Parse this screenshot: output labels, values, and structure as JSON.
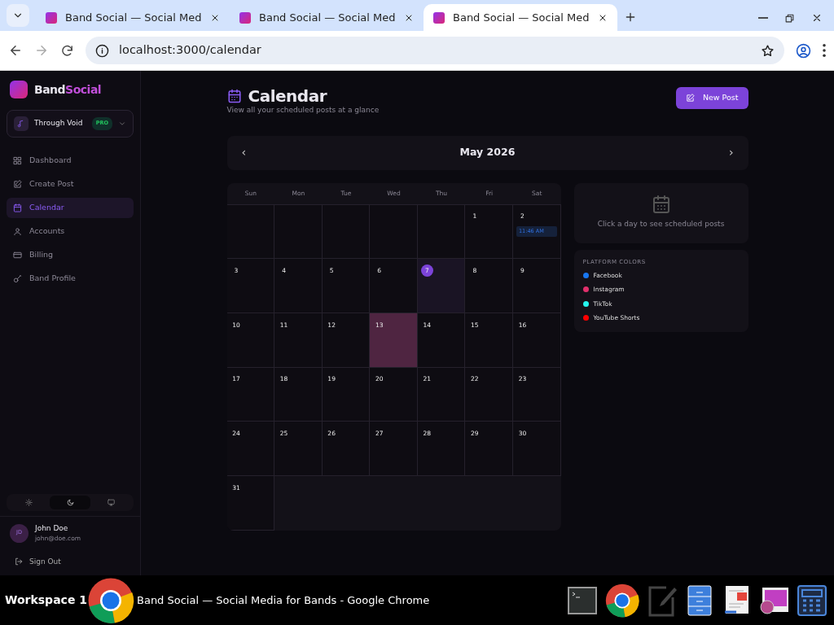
{
  "browser": {
    "tabs": [
      {
        "title": "Band Social — Social Med",
        "selected": false
      },
      {
        "title": "Band Social — Social Med",
        "selected": false
      },
      {
        "title": "Band Social — Social Med",
        "selected": true
      }
    ],
    "url": "localhost:3000/calendar"
  },
  "sidebar": {
    "brand": {
      "first": "Band",
      "second": "Social"
    },
    "band": {
      "name": "Through Void",
      "badge": "PRO"
    },
    "nav": [
      {
        "label": "Dashboard",
        "kind": "grid",
        "selected": false
      },
      {
        "label": "Create Post",
        "kind": "edit",
        "selected": false
      },
      {
        "label": "Calendar",
        "kind": "calendar",
        "selected": true
      },
      {
        "label": "Accounts",
        "kind": "user",
        "selected": false
      },
      {
        "label": "Billing",
        "kind": "card",
        "selected": false
      },
      {
        "label": "Band Profile",
        "kind": "guitar",
        "selected": false
      }
    ],
    "theme": [
      {
        "kind": "sun",
        "selected": false
      },
      {
        "kind": "moon",
        "selected": true
      },
      {
        "kind": "monitor",
        "selected": false
      }
    ],
    "user": {
      "initials": "JD",
      "name": "John Doe",
      "email": "john@doe.com"
    },
    "sign_out": "Sign Out"
  },
  "page": {
    "title": "Calendar",
    "subtitle": "View all your scheduled posts at a glance",
    "new_post": "New Post",
    "month": "May 2026",
    "prev": "‹",
    "next": "›",
    "weekdays": [
      "Sun",
      "Mon",
      "Tue",
      "Wed",
      "Thu",
      "Fri",
      "Sat"
    ],
    "days": [
      {
        "kind": "blank"
      },
      {
        "kind": "blank"
      },
      {
        "kind": "blank"
      },
      {
        "kind": "blank"
      },
      {
        "kind": "blank"
      },
      {
        "kind": "day",
        "label": "1",
        "today": false,
        "selected": false
      },
      {
        "kind": "day",
        "label": "2",
        "today": false,
        "selected": false,
        "events": [
          {
            "time": "11:46 AM"
          }
        ]
      },
      {
        "kind": "day",
        "label": "3",
        "today": false,
        "selected": false
      },
      {
        "kind": "day",
        "label": "4",
        "today": false,
        "selected": false
      },
      {
        "kind": "day",
        "label": "5",
        "today": false,
        "selected": false
      },
      {
        "kind": "day",
        "label": "6",
        "today": false,
        "selected": false
      },
      {
        "kind": "day",
        "label": "7",
        "today": true,
        "selected": false
      },
      {
        "kind": "day",
        "label": "8",
        "today": false,
        "selected": false
      },
      {
        "kind": "day",
        "label": "9",
        "today": false,
        "selected": false
      },
      {
        "kind": "day",
        "label": "10",
        "today": false,
        "selected": false
      },
      {
        "kind": "day",
        "label": "11",
        "today": false,
        "selected": false
      },
      {
        "kind": "day",
        "label": "12",
        "today": false,
        "selected": false
      },
      {
        "kind": "day",
        "label": "13",
        "today": false,
        "selected": true
      },
      {
        "kind": "day",
        "label": "14",
        "today": false,
        "selected": false
      },
      {
        "kind": "day",
        "label": "15",
        "today": false,
        "selected": false
      },
      {
        "kind": "day",
        "label": "16",
        "today": false,
        "selected": false
      },
      {
        "kind": "day",
        "label": "17",
        "today": false,
        "selected": false
      },
      {
        "kind": "day",
        "label": "18",
        "today": false,
        "selected": false
      },
      {
        "kind": "day",
        "label": "19",
        "today": false,
        "selected": false
      },
      {
        "kind": "day",
        "label": "20",
        "today": false,
        "selected": false
      },
      {
        "kind": "day",
        "label": "21",
        "today": false,
        "selected": false
      },
      {
        "kind": "day",
        "label": "22",
        "today": false,
        "selected": false
      },
      {
        "kind": "day",
        "label": "23",
        "today": false,
        "selected": false
      },
      {
        "kind": "day",
        "label": "24",
        "today": false,
        "selected": false
      },
      {
        "kind": "day",
        "label": "25",
        "today": false,
        "selected": false
      },
      {
        "kind": "day",
        "label": "26",
        "today": false,
        "selected": false
      },
      {
        "kind": "day",
        "label": "27",
        "today": false,
        "selected": false
      },
      {
        "kind": "day",
        "label": "28",
        "today": false,
        "selected": false
      },
      {
        "kind": "day",
        "label": "29",
        "today": false,
        "selected": false
      },
      {
        "kind": "day",
        "label": "30",
        "today": false,
        "selected": false
      },
      {
        "kind": "day",
        "label": "31",
        "today": false,
        "selected": false
      }
    ],
    "empty_text": "Click a day to see scheduled posts",
    "legend_title": "PLATFORM COLORS",
    "platforms": [
      {
        "name": "Facebook",
        "color": "#1877f2"
      },
      {
        "name": "Instagram",
        "color": "#e1306c"
      },
      {
        "name": "TikTok",
        "color": "#25f4ee"
      },
      {
        "name": "YouTube Shorts",
        "color": "#ff0000"
      }
    ]
  },
  "taskbar": {
    "workspace": "Workspace 1",
    "window": "Band Social — Social Media for Bands - Google Chrome"
  }
}
